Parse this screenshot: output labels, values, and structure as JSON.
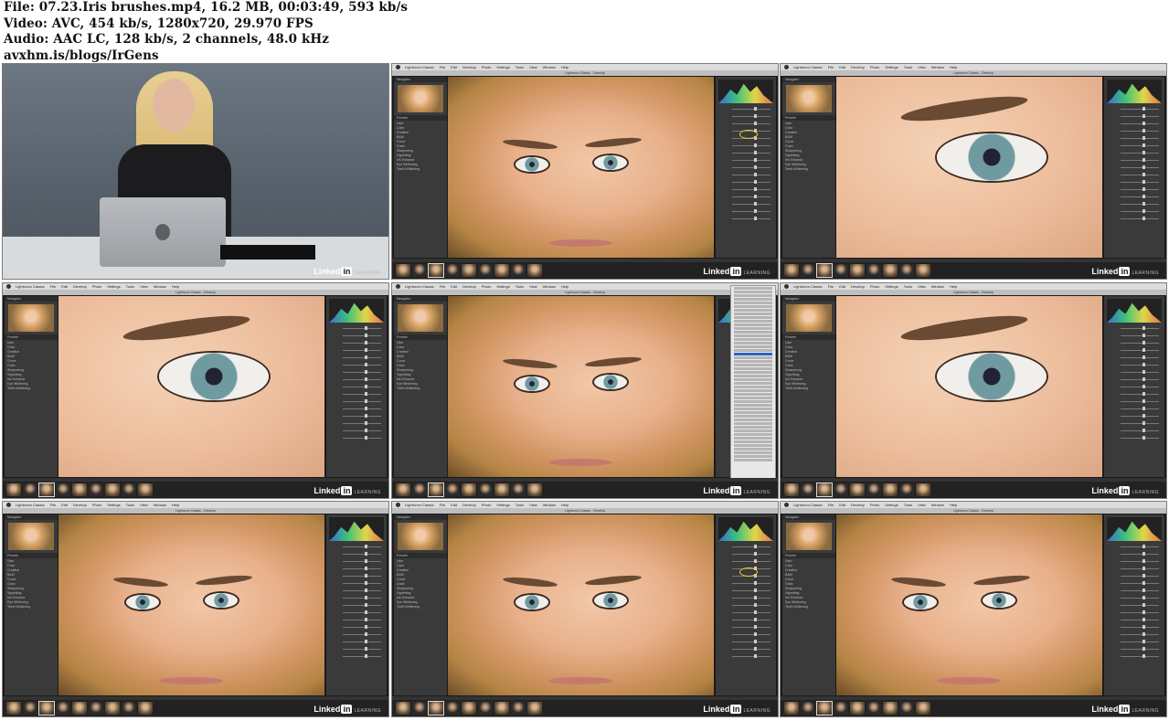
{
  "header": {
    "file_line": "File: 07.23.Iris brushes.mp4, 16.2 MB, 00:03:49, 593 kb/s",
    "video_line": "Video: AVC, 454 kb/s, 1280x720, 29.970 FPS",
    "audio_line": "Audio: AAC LC, 128 kb/s, 2 channels, 48.0 kHz",
    "site_line": "avxhm.is/blogs/IrGens"
  },
  "brand": {
    "name": "Linked",
    "in": "in",
    "sub": "LEARNING"
  },
  "lightroom": {
    "menu": [
      "Lightroom Classic",
      "File",
      "Edit",
      "Develop",
      "Photo",
      "Settings",
      "Tools",
      "View",
      "Window",
      "Help"
    ],
    "window_title": "Lightroom Classic - Develop",
    "navigator_label": "Navigator",
    "presets_label": "Presets",
    "preset_items": [
      "User",
      "Color",
      "Creative",
      "B&W",
      "Curve",
      "Grain",
      "Sharpening",
      "Vignetting",
      "Iris Enhance",
      "Eye Whitening",
      "Teeth Whitening"
    ]
  },
  "tiles": [
    {
      "id": "presenter"
    },
    {
      "id": "lr-face-circle",
      "view": "face",
      "annotation": "circle"
    },
    {
      "id": "lr-eye-1",
      "view": "eye"
    },
    {
      "id": "lr-eye-2",
      "view": "eye"
    },
    {
      "id": "lr-face-dropdown",
      "view": "face",
      "annotation": "dropdown"
    },
    {
      "id": "lr-eye-3",
      "view": "eye"
    },
    {
      "id": "lr-face-2",
      "view": "face"
    },
    {
      "id": "lr-face-3",
      "view": "face",
      "annotation": "circle"
    },
    {
      "id": "lr-face-4",
      "view": "face"
    }
  ]
}
